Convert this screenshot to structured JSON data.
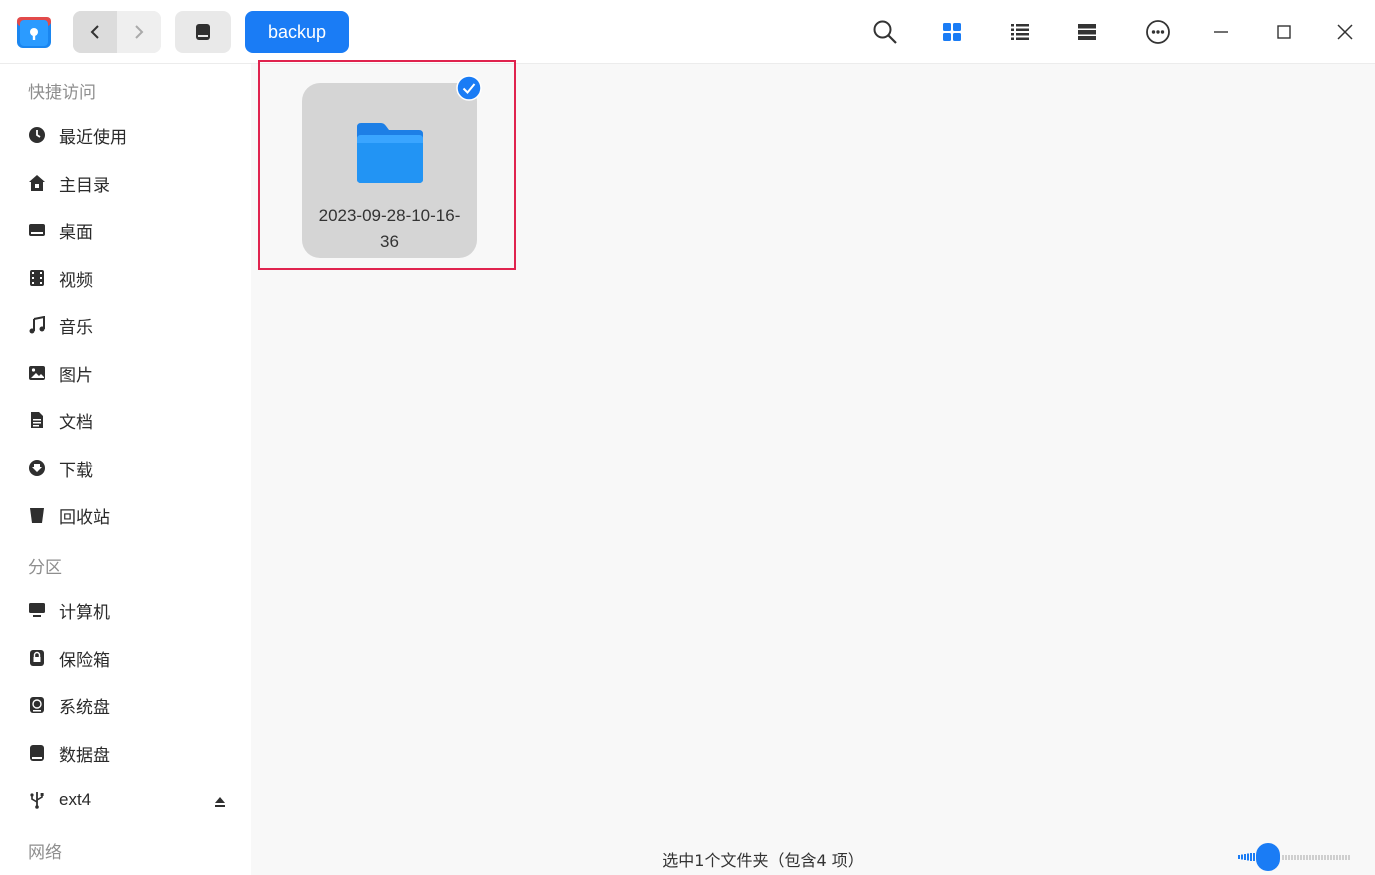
{
  "toolbar": {
    "breadcrumb_active": "backup"
  },
  "sidebar": {
    "quick_access_title": "快捷访问",
    "quick_items": [
      {
        "label": "最近使用",
        "icon": "clock-icon"
      },
      {
        "label": "主目录",
        "icon": "home-icon"
      },
      {
        "label": "桌面",
        "icon": "desktop-icon"
      },
      {
        "label": "视频",
        "icon": "video-icon"
      },
      {
        "label": "音乐",
        "icon": "music-icon"
      },
      {
        "label": "图片",
        "icon": "picture-icon"
      },
      {
        "label": "文档",
        "icon": "document-icon"
      },
      {
        "label": "下载",
        "icon": "download-icon"
      },
      {
        "label": "回收站",
        "icon": "trash-icon"
      }
    ],
    "partition_title": "分区",
    "partition_items": [
      {
        "label": "计算机",
        "icon": "computer-icon"
      },
      {
        "label": "保险箱",
        "icon": "vault-icon"
      },
      {
        "label": "系统盘",
        "icon": "system-disk-icon"
      },
      {
        "label": "数据盘",
        "icon": "data-disk-icon"
      },
      {
        "label": "ext4",
        "icon": "usb-icon"
      }
    ],
    "network_title": "网络"
  },
  "content": {
    "files": [
      {
        "name": "2023-09-28-10-16-36",
        "type": "folder",
        "selected": true
      }
    ],
    "status": "选中1个文件夹（包含4 项）",
    "zoom_level": 0.25
  },
  "colors": {
    "accent": "#1a7cf5",
    "highlight": "#e0234e"
  }
}
